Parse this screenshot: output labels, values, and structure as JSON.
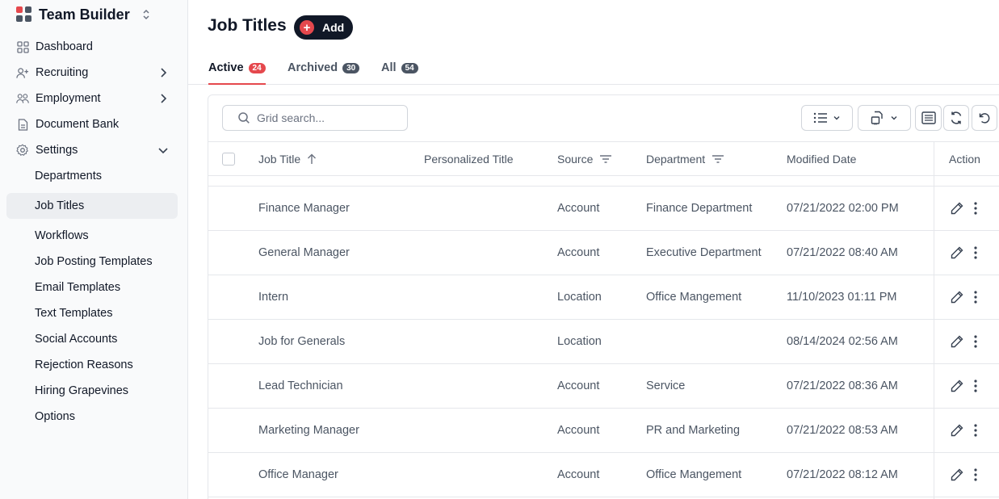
{
  "app": {
    "name": "Team Builder"
  },
  "sidebar": {
    "items": [
      {
        "label": "Dashboard",
        "icon": "dashboard-icon"
      },
      {
        "label": "Recruiting",
        "icon": "user-plus-icon"
      },
      {
        "label": "Employment",
        "icon": "users-icon"
      },
      {
        "label": "Document Bank",
        "icon": "document-icon"
      },
      {
        "label": "Settings",
        "icon": "gear-icon"
      }
    ],
    "settings_subitems": [
      "Departments",
      "Job Titles",
      "Workflows",
      "Job Posting Templates",
      "Email Templates",
      "Text Templates",
      "Social Accounts",
      "Rejection Reasons",
      "Hiring Grapevines",
      "Options"
    ],
    "active_subitem": "Job Titles"
  },
  "page": {
    "title": "Job Titles",
    "add_label": "Add"
  },
  "tabs": [
    {
      "label": "Active",
      "count": "24",
      "active": true
    },
    {
      "label": "Archived",
      "count": "30",
      "active": false
    },
    {
      "label": "All",
      "count": "54",
      "active": false
    }
  ],
  "search": {
    "placeholder": "Grid search..."
  },
  "columns": {
    "job_title": "Job Title",
    "personalized_title": "Personalized Title",
    "source": "Source",
    "department": "Department",
    "modified_date": "Modified Date",
    "action": "Action"
  },
  "rows": [
    {
      "job_title": "Finance Manager",
      "personalized_title": "",
      "source": "Account",
      "department": "Finance Department",
      "modified_date": "07/21/2022 02:00 PM"
    },
    {
      "job_title": "General Manager",
      "personalized_title": "",
      "source": "Account",
      "department": "Executive Department",
      "modified_date": "07/21/2022 08:40 AM"
    },
    {
      "job_title": "Intern",
      "personalized_title": "",
      "source": "Location",
      "department": "Office Mangement",
      "modified_date": "11/10/2023 01:11 PM"
    },
    {
      "job_title": "Job for Generals",
      "personalized_title": "",
      "source": "Location",
      "department": "",
      "modified_date": "08/14/2024 02:56 AM"
    },
    {
      "job_title": "Lead Technician",
      "personalized_title": "",
      "source": "Account",
      "department": "Service",
      "modified_date": "07/21/2022 08:36 AM"
    },
    {
      "job_title": "Marketing Manager",
      "personalized_title": "",
      "source": "Account",
      "department": "PR and Marketing",
      "modified_date": "07/21/2022 08:53 AM"
    },
    {
      "job_title": "Office Manager",
      "personalized_title": "",
      "source": "Account",
      "department": "Office Mangement",
      "modified_date": "07/21/2022 08:12 AM"
    }
  ],
  "colors": {
    "accent": "#e5484d",
    "dark": "#111827"
  }
}
